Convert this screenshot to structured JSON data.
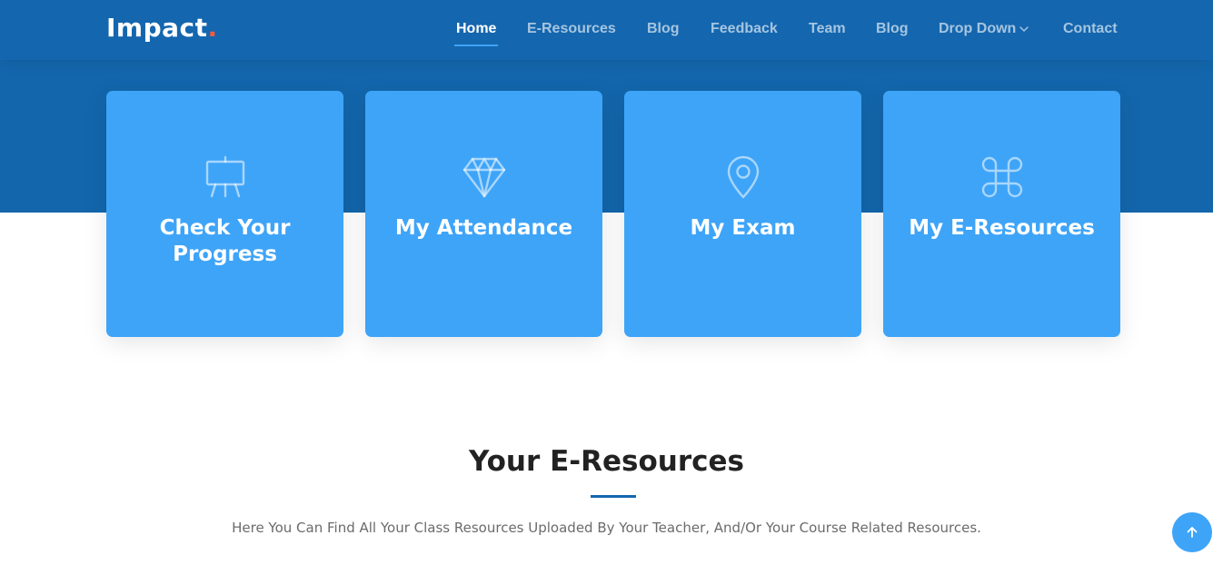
{
  "header": {
    "logo_text": "Impact",
    "logo_dot": "."
  },
  "nav": [
    {
      "label": "Home"
    },
    {
      "label": "E-Resources"
    },
    {
      "label": "Blog"
    },
    {
      "label": "Feedback"
    },
    {
      "label": "Team"
    },
    {
      "label": "Blog"
    },
    {
      "label": "Drop Down"
    },
    {
      "label": "Contact"
    }
  ],
  "cards": [
    {
      "label": "Check Your Progress",
      "icon": "easel-icon"
    },
    {
      "label": "My Attendance",
      "icon": "gem-icon"
    },
    {
      "label": "My Exam",
      "icon": "map-pin-icon"
    },
    {
      "label": "My E-Resources",
      "icon": "command-icon"
    }
  ],
  "section": {
    "title": "Your E-Resources",
    "description": "Here You Can Find All Your Class Resources Uploaded By Your Teacher, And/Or Your Course Related Resources."
  },
  "colors": {
    "header_bg": "#1466ae",
    "card_bg": "#3ea4f8",
    "logo_accent": "#f85a40"
  }
}
